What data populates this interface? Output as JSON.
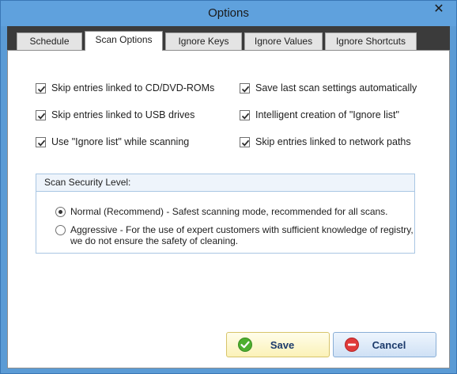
{
  "window": {
    "title": "Options",
    "close_glyph": "✕"
  },
  "tabs": [
    {
      "label": "Schedule",
      "active": false
    },
    {
      "label": "Scan Options",
      "active": true
    },
    {
      "label": "Ignore Keys",
      "active": false
    },
    {
      "label": "Ignore Values",
      "active": false
    },
    {
      "label": "Ignore Shortcuts",
      "active": false
    }
  ],
  "options": {
    "left": [
      {
        "label": "Skip entries linked to CD/DVD-ROMs",
        "checked": true
      },
      {
        "label": "Skip entries linked to USB drives",
        "checked": true
      },
      {
        "label": "Use \"Ignore list\" while scanning",
        "checked": true
      }
    ],
    "right": [
      {
        "label": "Save last scan settings automatically",
        "checked": true
      },
      {
        "label": "Intelligent creation of \"Ignore list\"",
        "checked": true
      },
      {
        "label": "Skip entries linked to network paths",
        "checked": true
      }
    ]
  },
  "security": {
    "header": "Scan Security Level:",
    "normal_label": "Normal (Recommend) - Safest scanning mode, recommended for all scans.",
    "aggressive_line1": "Aggressive - For the use of expert customers with sufficient knowledge of registry,",
    "aggressive_line2": "we do not ensure the safety of cleaning.",
    "selected": "normal"
  },
  "buttons": {
    "save_label": "Save",
    "cancel_label": "Cancel"
  },
  "colors": {
    "titlebar": "#5fa1dd",
    "save_icon": "#4caf2f",
    "cancel_icon": "#e03a3a"
  }
}
